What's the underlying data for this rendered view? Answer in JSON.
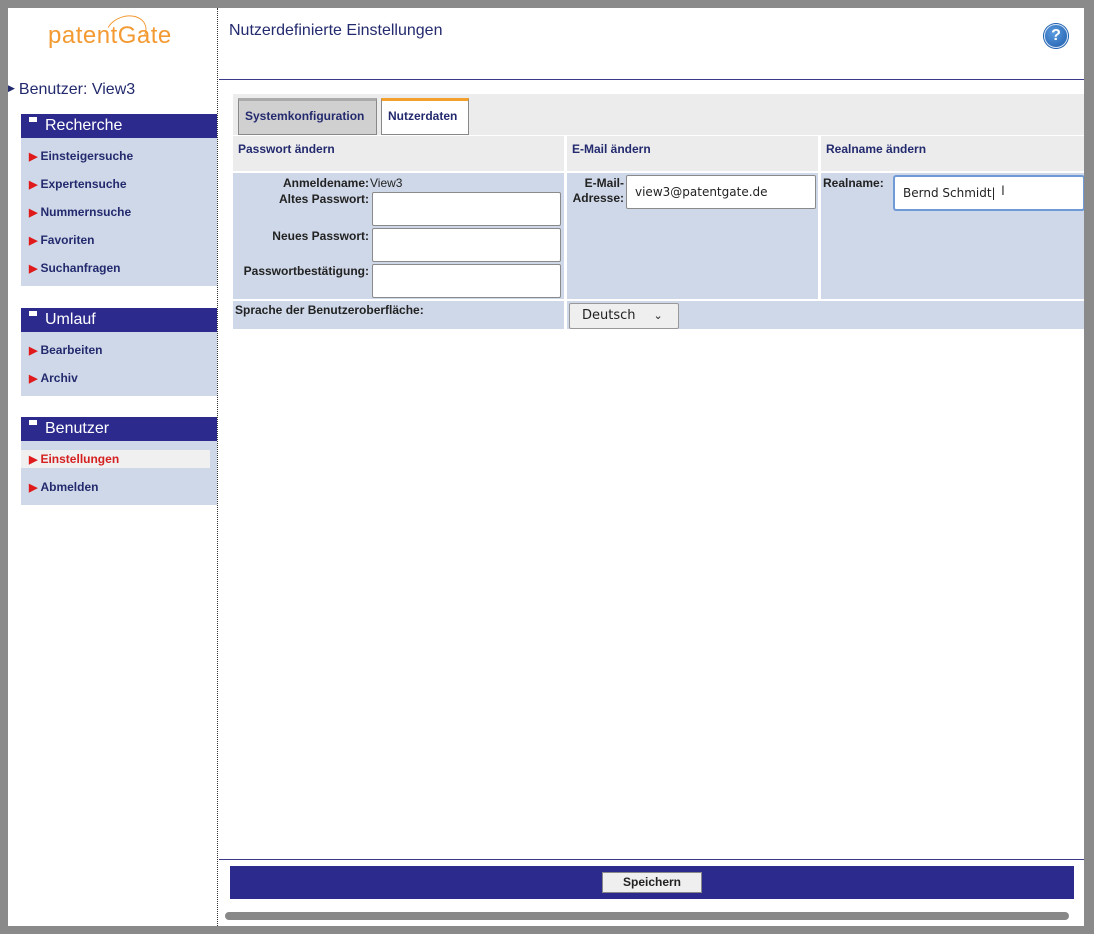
{
  "brand": {
    "logo_text_a": "paten",
    "logo_text_b": "tGate"
  },
  "sidebar": {
    "user_label": "Benutzer: View3",
    "sections": [
      {
        "title": "Recherche",
        "items": [
          "Einsteigersuche",
          "Expertensuche",
          "Nummernsuche",
          "Favoriten",
          "Suchanfragen"
        ]
      },
      {
        "title": "Umlauf",
        "items": [
          "Bearbeiten",
          "Archiv"
        ]
      },
      {
        "title": "Benutzer",
        "items": [
          "Einstellungen",
          "Abmelden"
        ],
        "active": "Einstellungen"
      }
    ]
  },
  "header": {
    "title": "Nutzerdefinierte Einstellungen",
    "help": "?"
  },
  "tabs": [
    {
      "label": "Systemkonfiguration"
    },
    {
      "label": "Nutzerdaten",
      "active": true
    }
  ],
  "password": {
    "heading": "Passwort ändern",
    "login_label": "Anmeldename:",
    "login_value": "View3",
    "old_label": "Altes Passwort:",
    "new_label": "Neues Passwort:",
    "confirm_label": "Passwortbestätigung:"
  },
  "email": {
    "heading": "E-Mail ändern",
    "label_a": "E-Mail-",
    "label_b": "Adresse:",
    "value": "view3@patentgate.de"
  },
  "realname": {
    "heading": "Realname ändern",
    "label": "Realname:",
    "value": "Bernd Schmidt"
  },
  "language": {
    "label": "Sprache der Benutzeroberfläche:",
    "selected": "Deutsch"
  },
  "footer": {
    "save_label": "Speichern"
  },
  "colors": {
    "nav_blue": "#2c2a8c",
    "panel_blue": "#cfd8e8",
    "accent_orange": "#f39a32",
    "link_red": "#e01a1a"
  }
}
